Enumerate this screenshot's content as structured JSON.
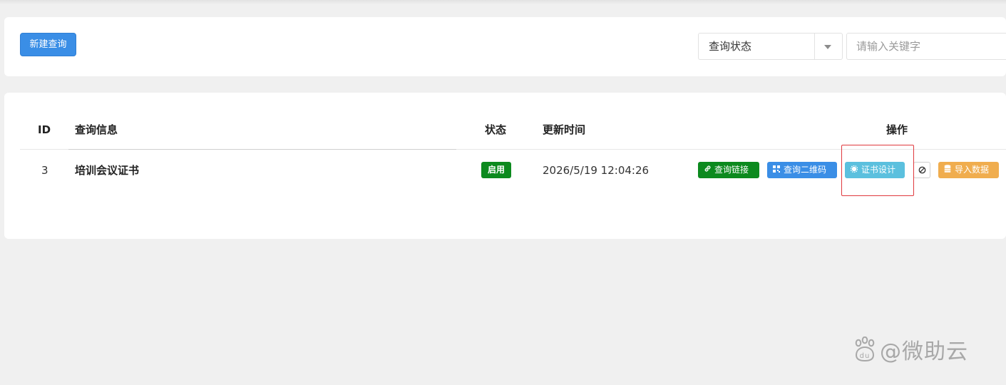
{
  "toolbar": {
    "new_button": "新建查询",
    "status_select": {
      "value": "查询状态"
    },
    "keyword_input": {
      "value": "",
      "placeholder": "请输入关键字"
    }
  },
  "table": {
    "columns": {
      "id": "ID",
      "info": "查询信息",
      "status": "状态",
      "updated": "更新时间",
      "actions": "操作"
    },
    "rows": [
      {
        "id": "3",
        "info": "培训会议证书",
        "status": "启用",
        "updated": "2026/5/19 12:04:26",
        "actions": {
          "link": "查询链接",
          "qrcode": "查询二维码",
          "design": "证书设计",
          "disable_icon": "ban-icon",
          "import": "导入数据"
        }
      }
    ]
  },
  "watermark": {
    "text": "@微助云",
    "icon": "baidu-paw-icon"
  },
  "colors": {
    "primary": "#3a8ee6",
    "success": "#0c8a1e",
    "info": "#5bc0de",
    "warning": "#f0ad4e",
    "highlight": "#e0393e"
  }
}
